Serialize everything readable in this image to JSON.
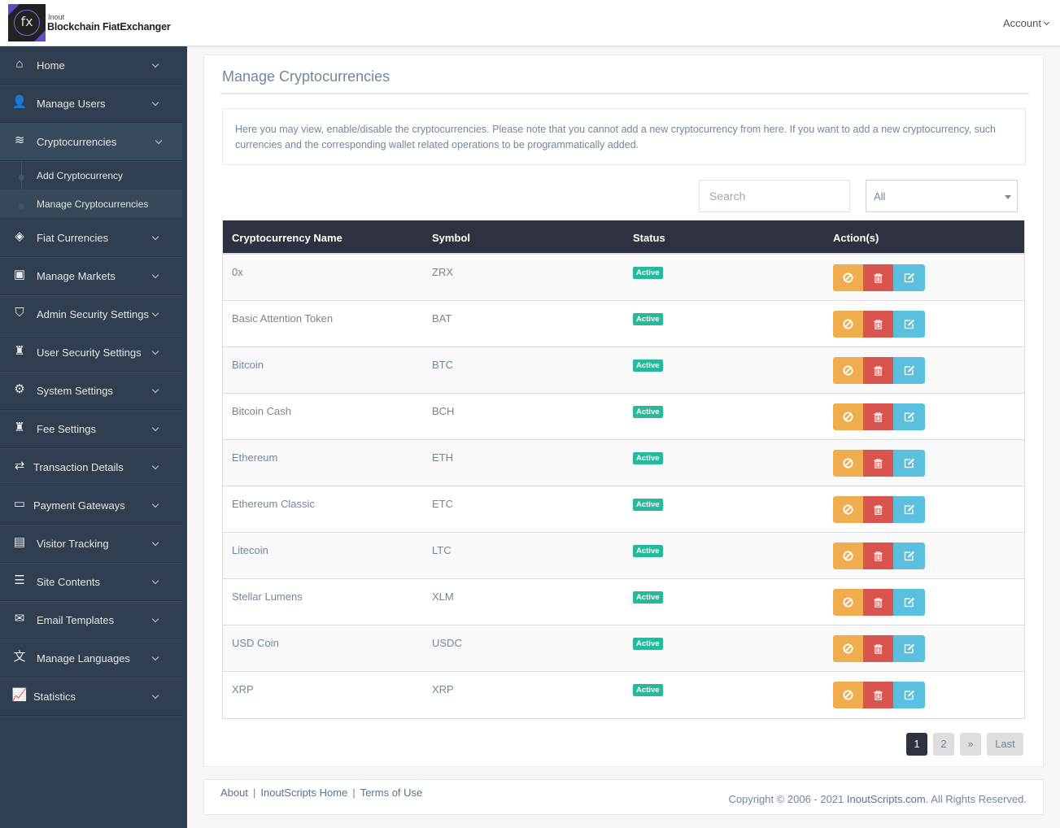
{
  "header": {
    "logo_glyph": "fx",
    "brand_small": "Inout",
    "brand_name": "Blockchain FiatExchanger",
    "account_label": "Account"
  },
  "sidebar": {
    "items": [
      {
        "label": "Home",
        "icon": "home-icon",
        "glyph": "⌂"
      },
      {
        "label": "Manage Users",
        "icon": "user-icon",
        "glyph": "👤"
      },
      {
        "label": "Cryptocurrencies",
        "icon": "database-icon",
        "glyph": "≋",
        "active": true,
        "children": [
          {
            "label": "Add Cryptocurrency"
          },
          {
            "label": "Manage Cryptocurrencies",
            "current": true
          }
        ]
      },
      {
        "label": "Fiat Currencies",
        "icon": "ticket-icon",
        "glyph": "◈"
      },
      {
        "label": "Manage Markets",
        "icon": "money-icon",
        "glyph": "▣"
      },
      {
        "label": "Admin Security Settings",
        "icon": "shield-icon",
        "glyph": "⛉"
      },
      {
        "label": "User Security Settings",
        "icon": "user-secret-icon",
        "glyph": "♜"
      },
      {
        "label": "System Settings",
        "icon": "gear-icon",
        "glyph": "⚙"
      },
      {
        "label": "Fee Settings",
        "icon": "user-secret-icon",
        "glyph": "♜"
      },
      {
        "label": "Transaction Details",
        "icon": "exchange-icon",
        "glyph": "⇄"
      },
      {
        "label": "Payment Gateways",
        "icon": "credit-card-icon",
        "glyph": "▭"
      },
      {
        "label": "Visitor Tracking",
        "icon": "address-book-icon",
        "glyph": "▤"
      },
      {
        "label": "Site Contents",
        "icon": "list-alt-icon",
        "glyph": "☰"
      },
      {
        "label": "Email Templates",
        "icon": "envelope-icon",
        "glyph": "✉"
      },
      {
        "label": "Manage Languages",
        "icon": "language-icon",
        "glyph": "文"
      },
      {
        "label": "Statistics",
        "icon": "line-chart-icon",
        "glyph": "📈"
      }
    ]
  },
  "main": {
    "title": "Manage Cryptocurrencies",
    "note": "Here you may view, enable/disable the cryptocurrencies. Please note that you cannot add a new cryptocurrency from here. If you want to add a new cryptocurrency, such currencies and the corresponding wallet related operations to be programmatically added.",
    "search_placeholder": "Search",
    "search_value": "",
    "filter_selected": "All",
    "table": {
      "columns": [
        "Cryptocurrency Name",
        "Symbol",
        "Status",
        "Action(s)"
      ],
      "rows": [
        {
          "name": "0x",
          "symbol": "ZRX",
          "status": "Active"
        },
        {
          "name": "Basic Attention Token",
          "symbol": "BAT",
          "status": "Active"
        },
        {
          "name": "Bitcoin",
          "symbol": "BTC",
          "status": "Active"
        },
        {
          "name": "Bitcoin Cash",
          "symbol": "BCH",
          "status": "Active"
        },
        {
          "name": "Ethereum",
          "symbol": "ETH",
          "status": "Active"
        },
        {
          "name": "Ethereum Classic",
          "symbol": "ETC",
          "status": "Active"
        },
        {
          "name": "Litecoin",
          "symbol": "LTC",
          "status": "Active"
        },
        {
          "name": "Stellar Lumens",
          "symbol": "XLM",
          "status": "Active"
        },
        {
          "name": "USD Coin",
          "symbol": "USDC",
          "status": "Active"
        },
        {
          "name": "XRP",
          "symbol": "XRP",
          "status": "Active"
        }
      ],
      "action_icons": [
        "ban-icon",
        "trash-icon",
        "edit-icon"
      ]
    },
    "pagination": {
      "pages": [
        "1",
        "2"
      ],
      "current": "1",
      "next_label": "»",
      "last_label": "Last"
    }
  },
  "footer": {
    "links": [
      "About",
      "InoutScripts Home",
      "Terms of Use"
    ],
    "separator": "|",
    "copyright_prefix": "Copyright © 2006 - 2021 ",
    "copyright_brand": "InoutScripts.com",
    "copyright_suffix": ". All Rights Reserved."
  },
  "colors": {
    "sidebar_bg": "#2f3f51",
    "table_header_bg": "#2e3240",
    "status_active": "#26b99a",
    "btn_warning": "#f0ad4e",
    "btn_danger": "#d9534f",
    "btn_info": "#5bc0de"
  }
}
